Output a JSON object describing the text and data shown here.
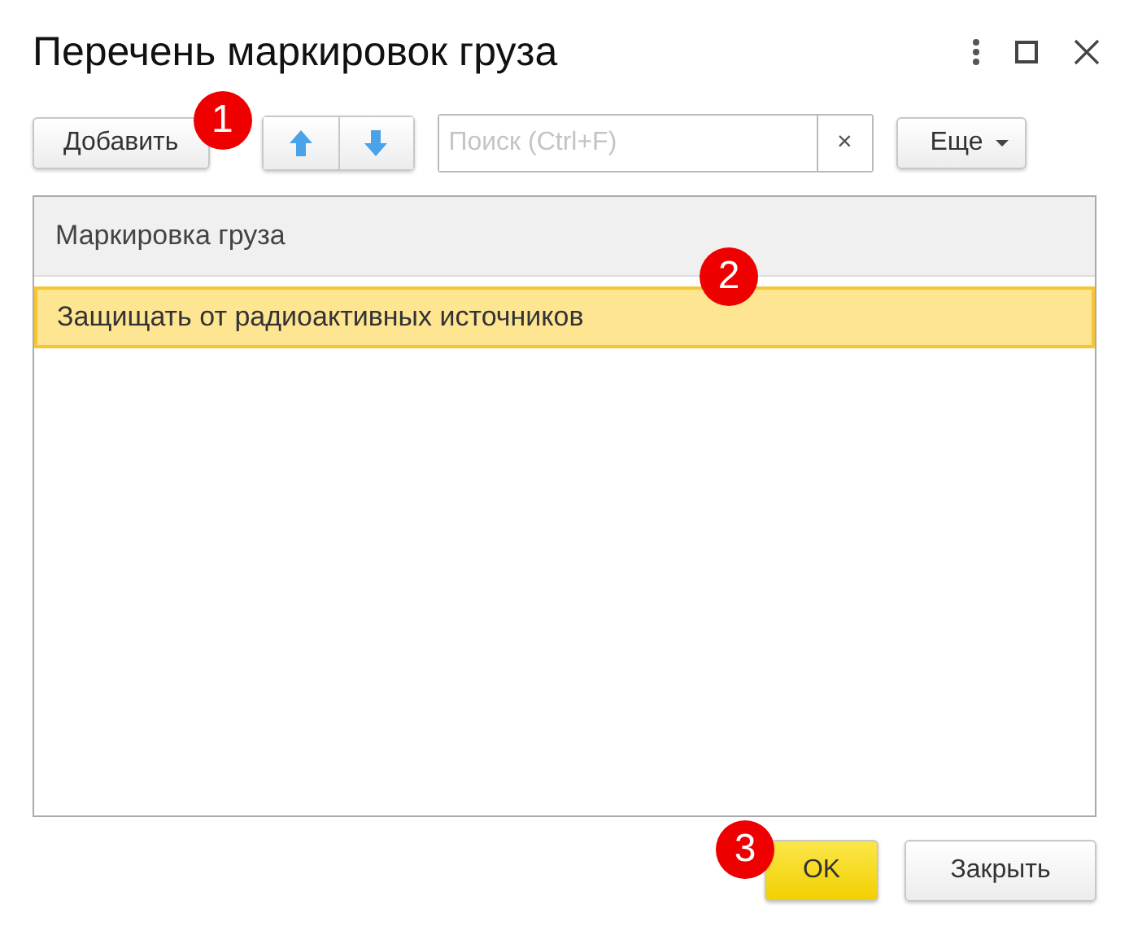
{
  "window": {
    "title": "Перечень маркировок груза"
  },
  "toolbar": {
    "add_button": "Добавить",
    "search": {
      "placeholder": "Поиск (Ctrl+F)",
      "clear": "×"
    },
    "more_button": "Еще"
  },
  "table": {
    "columns": [
      "Маркировка груза"
    ],
    "rows": [
      {
        "cells": [
          "Защищать от радиоактивных источников"
        ],
        "selected": true
      }
    ]
  },
  "buttons": [
    {
      "label": "OK",
      "kind": "primary"
    },
    {
      "label": "Закрыть",
      "kind": "default"
    }
  ],
  "callouts": [
    "1",
    "2",
    "3"
  ]
}
